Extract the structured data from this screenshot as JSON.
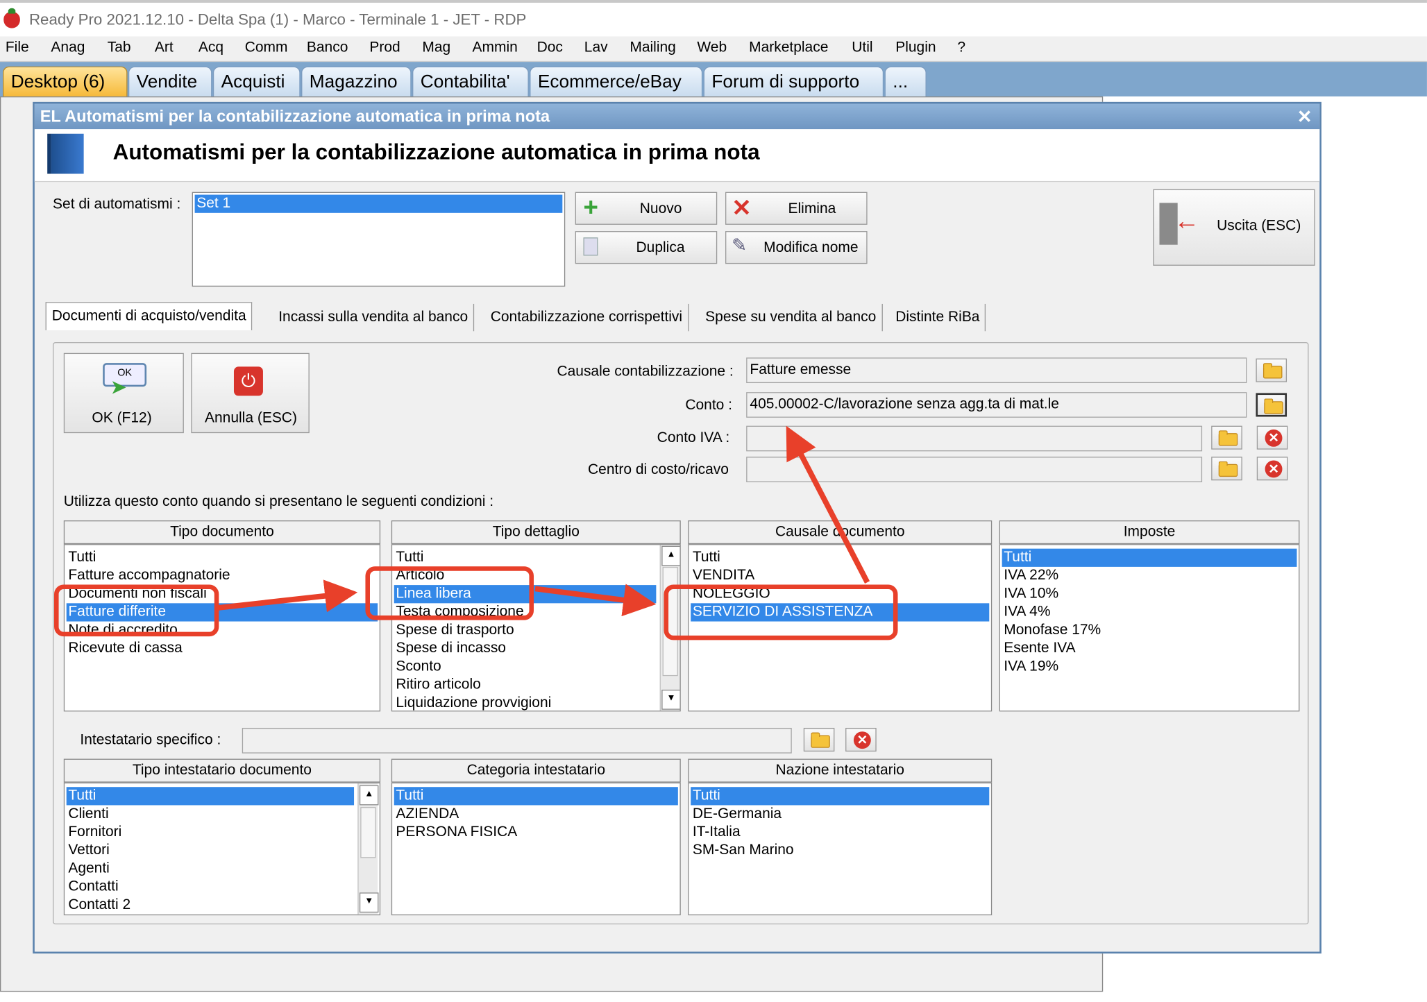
{
  "window": {
    "title": "Ready Pro 2021.12.10 - Delta Spa (1) - Marco - Terminale 1 - JET - RDP"
  },
  "menu": [
    "File",
    "Anag",
    "Tab",
    "Art",
    "Acq",
    "Comm",
    "Banco",
    "Prod",
    "Mag",
    "Ammin",
    "Doc",
    "Lav",
    "Mailing",
    "Web",
    "Marketplace",
    "Util",
    "Plugin",
    "?"
  ],
  "module_tabs": [
    "Desktop (6)",
    "Vendite",
    "Acquisti",
    "Magazzino",
    "Contabilita'",
    "Ecommerce/eBay",
    "Forum di supporto",
    "..."
  ],
  "dialog": {
    "caption": "Automatismi per la contabilizzazione automatica in prima nota",
    "caption_prefix": "EL",
    "heading": "Automatismi per la contabilizzazione automatica in prima nota",
    "set_label": "Set di automatismi :",
    "sets": [
      "Set 1"
    ],
    "buttons": {
      "nuovo": "Nuovo",
      "elimina": "Elimina",
      "duplica": "Duplica",
      "modifica": "Modifica nome",
      "uscita": "Uscita (ESC)"
    },
    "tabs": [
      "Documenti di acquisto/vendita",
      "Incassi sulla vendita al banco",
      "Contabilizzazione corrispettivi",
      "Spese su vendita al banco",
      "Distinte RiBa"
    ],
    "ok_label": "OK (F12)",
    "ok_icon_text": "OK",
    "annulla_label": "Annulla (ESC)",
    "fields": {
      "causale_label": "Causale contabilizzazione :",
      "causale_value": "Fatture emesse",
      "conto_label": "Conto :",
      "conto_value": "405.00002-C/lavorazione senza agg.ta di mat.le",
      "contoiva_label": "Conto IVA :",
      "contoiva_value": "",
      "centro_label": "Centro di costo/ricavo",
      "centro_value": ""
    },
    "conditions_label": "Utilizza questo conto quando si presentano le seguenti condizioni :",
    "tipo_documento": {
      "header": "Tipo documento",
      "items": [
        "Tutti",
        "Fatture accompagnatorie",
        "Documenti non fiscali",
        "Fatture differite",
        "Note di accredito",
        "Ricevute di cassa"
      ]
    },
    "tipo_dettaglio": {
      "header": "Tipo dettaglio",
      "items": [
        "Tutti",
        "Articolo",
        "Linea libera",
        "Testa composizione",
        "Spese di trasporto",
        "Spese di incasso",
        "Sconto",
        "Ritiro articolo",
        "Liquidazione provvigioni"
      ]
    },
    "causale_documento": {
      "header": "Causale documento",
      "items": [
        "Tutti",
        "VENDITA",
        "NOLEGGIO",
        "SERVIZIO DI ASSISTENZA"
      ]
    },
    "imposte": {
      "header": "Imposte",
      "items": [
        "Tutti",
        "IVA 22%",
        "IVA 10%",
        "IVA 4%",
        "Monofase 17%",
        "Esente IVA",
        "IVA 19%"
      ]
    },
    "intestatario_label": "Intestatario specifico :",
    "intestatario_value": "",
    "tipo_intestatario": {
      "header": "Tipo intestatario documento",
      "items": [
        "Tutti",
        "Clienti",
        "Fornitori",
        "Vettori",
        "Agenti",
        "Contatti",
        "Contatti 2"
      ]
    },
    "categoria_intestatario": {
      "header": "Categoria intestatario",
      "items": [
        "Tutti",
        "AZIENDA",
        "PERSONA FISICA"
      ]
    },
    "nazione_intestatario": {
      "header": "Nazione intestatario",
      "items": [
        "Tutti",
        "DE-Germania",
        "IT-Italia",
        "SM-San Marino"
      ]
    }
  },
  "colors": {
    "selection": "#3388e8",
    "annotation": "#e8402a",
    "title_bar": "#6f96c2"
  }
}
